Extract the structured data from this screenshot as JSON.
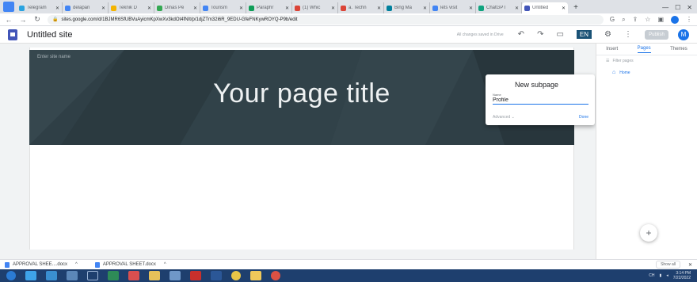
{
  "browser": {
    "tabs": [
      {
        "label": "Telegram",
        "color": "#2aa3e0"
      },
      {
        "label": "delapan",
        "color": "#4285f4"
      },
      {
        "label": "Teknik D",
        "color": "#f4b400"
      },
      {
        "label": "Dinas Pe",
        "color": "#34a853"
      },
      {
        "label": "Tourism",
        "color": "#4285f4"
      },
      {
        "label": "Paraphr",
        "color": "#0f9d58"
      },
      {
        "label": "(1) Whic",
        "color": "#db4437"
      },
      {
        "label": "a. Techn",
        "color": "#db4437"
      },
      {
        "label": "Bing Ma",
        "color": "#00809d"
      },
      {
        "label": "lets visit",
        "color": "#4285f4"
      },
      {
        "label": "ChatGPT",
        "color": "#10a37f"
      },
      {
        "label": "Untitled",
        "color": "#4255b8"
      }
    ],
    "new_tab": "+",
    "url": "sites.google.com/d/1BJMR6SfUBVuAyicmKpXwXv3kdOt4fNIt/p/1djZTm32i6R_9EDU-GfeFNKywROYQ-P9b/edit"
  },
  "sites": {
    "site_title": "Untitled site",
    "saved_status": "All changes saved in Drive",
    "lang_indicator": "EN ",
    "publish_label": "Publish",
    "avatar_letter": "M"
  },
  "canvas": {
    "site_name_placeholder": "Enter site name",
    "page_title": "Your page title",
    "hero_color": "#2f3f46"
  },
  "dialog": {
    "title": "New subpage",
    "name_label": "Name",
    "name_value": "Profile",
    "advanced_label": "Advanced",
    "done_label": "Done"
  },
  "right_panel": {
    "tabs": [
      "Insert",
      "Pages",
      "Themes"
    ],
    "active_tab": "Pages",
    "filter_placeholder": "Filter pages",
    "pages": [
      "Home"
    ]
  },
  "downloads": {
    "items": [
      "APPROVAL SHEE....docx",
      "APPROVAL SHEET.docx"
    ],
    "show_all": "Show all"
  },
  "taskbar": {
    "lang": "CH",
    "time": "3:14 PM",
    "date": "7/22/2022"
  }
}
